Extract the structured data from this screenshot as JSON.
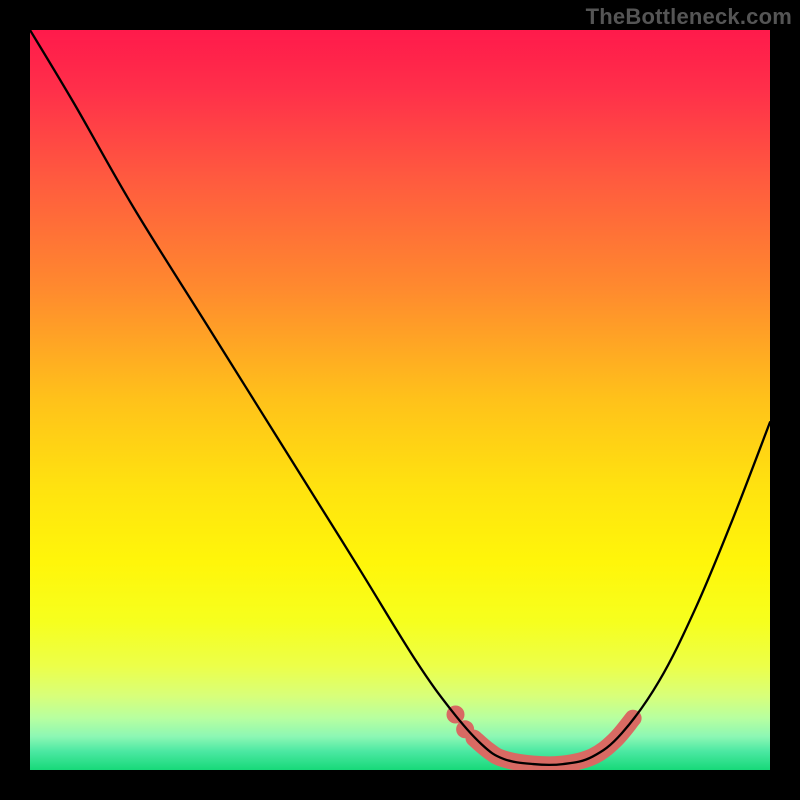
{
  "watermark": "TheBottleneck.com",
  "chart_data": {
    "type": "line",
    "title": "",
    "xlabel": "",
    "ylabel": "",
    "xlim": [
      0,
      100
    ],
    "ylim": [
      0,
      100
    ],
    "grid": false,
    "legend": false,
    "background_gradient": {
      "stops": [
        {
          "offset": 0.0,
          "color": "#ff1a4b"
        },
        {
          "offset": 0.08,
          "color": "#ff2f4a"
        },
        {
          "offset": 0.2,
          "color": "#ff5a3f"
        },
        {
          "offset": 0.35,
          "color": "#ff8a2e"
        },
        {
          "offset": 0.5,
          "color": "#ffc21a"
        },
        {
          "offset": 0.62,
          "color": "#ffe30f"
        },
        {
          "offset": 0.72,
          "color": "#fff60a"
        },
        {
          "offset": 0.8,
          "color": "#f6ff1e"
        },
        {
          "offset": 0.86,
          "color": "#ecff4a"
        },
        {
          "offset": 0.9,
          "color": "#d8ff7a"
        },
        {
          "offset": 0.93,
          "color": "#b7ffa0"
        },
        {
          "offset": 0.955,
          "color": "#8cf7b4"
        },
        {
          "offset": 0.975,
          "color": "#4be8a2"
        },
        {
          "offset": 1.0,
          "color": "#17d979"
        }
      ]
    },
    "series": [
      {
        "name": "bottleneck-curve",
        "color": "#000000",
        "stroke_width": 2.3,
        "points": [
          {
            "x": 0.0,
            "y": 100.0
          },
          {
            "x": 6.0,
            "y": 90.0
          },
          {
            "x": 14.0,
            "y": 76.0
          },
          {
            "x": 24.0,
            "y": 60.0
          },
          {
            "x": 34.0,
            "y": 44.0
          },
          {
            "x": 44.0,
            "y": 28.0
          },
          {
            "x": 52.0,
            "y": 15.0
          },
          {
            "x": 57.0,
            "y": 8.0
          },
          {
            "x": 61.0,
            "y": 3.5
          },
          {
            "x": 64.0,
            "y": 1.5
          },
          {
            "x": 68.0,
            "y": 0.8
          },
          {
            "x": 72.0,
            "y": 0.8
          },
          {
            "x": 76.0,
            "y": 1.8
          },
          {
            "x": 80.0,
            "y": 5.0
          },
          {
            "x": 85.0,
            "y": 12.0
          },
          {
            "x": 90.0,
            "y": 22.0
          },
          {
            "x": 95.0,
            "y": 34.0
          },
          {
            "x": 100.0,
            "y": 47.0
          }
        ]
      },
      {
        "name": "highlight-band",
        "color": "#d86a63",
        "stroke_width": 17,
        "points": [
          {
            "x": 60.0,
            "y": 4.3
          },
          {
            "x": 62.0,
            "y": 2.6
          },
          {
            "x": 64.0,
            "y": 1.5
          },
          {
            "x": 68.0,
            "y": 0.8
          },
          {
            "x": 72.0,
            "y": 0.8
          },
          {
            "x": 76.0,
            "y": 1.8
          },
          {
            "x": 79.0,
            "y": 4.0
          },
          {
            "x": 81.5,
            "y": 7.0
          }
        ]
      },
      {
        "name": "highlight-dots",
        "color": "#d86a63",
        "radius": 9,
        "points": [
          {
            "x": 57.5,
            "y": 7.5
          },
          {
            "x": 58.8,
            "y": 5.5
          }
        ]
      }
    ]
  }
}
